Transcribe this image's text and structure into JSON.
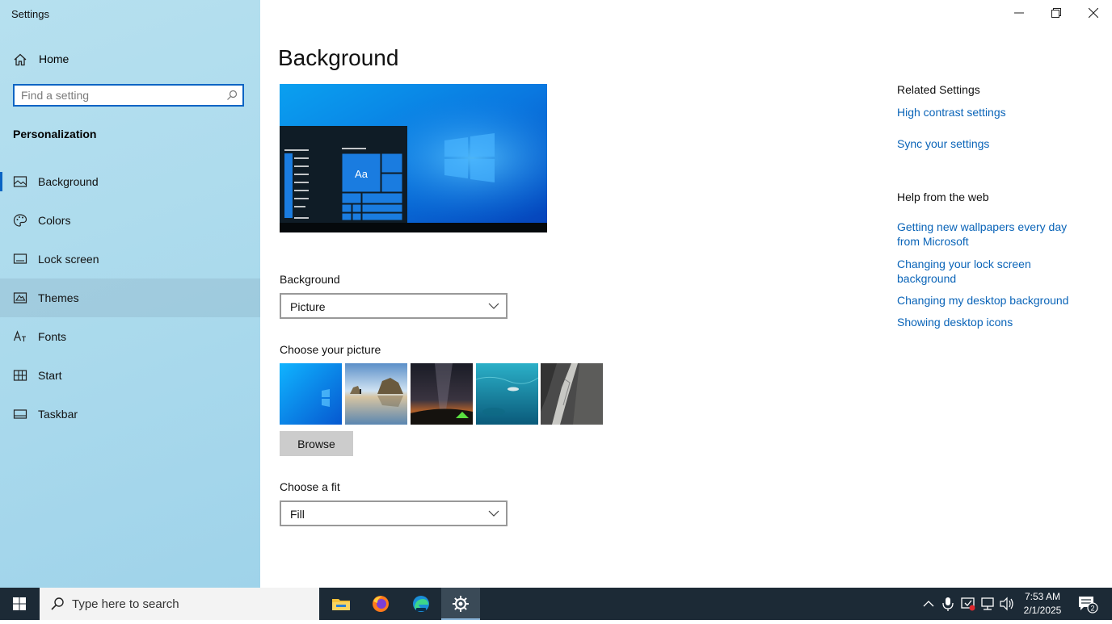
{
  "window": {
    "title": "Settings",
    "controls": [
      "minimize",
      "restore",
      "close"
    ]
  },
  "sidebar": {
    "home_label": "Home",
    "search_placeholder": "Find a setting",
    "section_label": "Personalization",
    "items": [
      {
        "label": "Background",
        "icon": "picture-icon",
        "active": true
      },
      {
        "label": "Colors",
        "icon": "palette-icon"
      },
      {
        "label": "Lock screen",
        "icon": "lock-screen-icon"
      },
      {
        "label": "Themes",
        "icon": "themes-icon",
        "hovered": true
      },
      {
        "label": "Fonts",
        "icon": "fonts-icon"
      },
      {
        "label": "Start",
        "icon": "start-icon"
      },
      {
        "label": "Taskbar",
        "icon": "taskbar-icon"
      }
    ]
  },
  "main": {
    "title": "Background",
    "preview": {
      "tile_text": "Aa"
    },
    "background_label": "Background",
    "background_value": "Picture",
    "choose_picture_label": "Choose your picture",
    "pictures": [
      "windows-blue",
      "beach-rocks",
      "night-sky-tent",
      "underwater-swimmer",
      "rock-cliff"
    ],
    "browse_label": "Browse",
    "fit_label": "Choose a fit",
    "fit_value": "Fill"
  },
  "related": {
    "heading": "Related Settings",
    "links": [
      "High contrast settings",
      "Sync your settings"
    ],
    "help_heading": "Help from the web",
    "help_links": [
      "Getting new wallpapers every day from Microsoft",
      "Changing your lock screen background",
      "Changing my desktop background",
      "Showing desktop icons"
    ]
  },
  "taskbar": {
    "search_placeholder": "Type here to search",
    "apps": [
      "file-explorer",
      "firefox",
      "edge",
      "settings"
    ],
    "active_app": "settings",
    "time": "7:53 AM",
    "date": "2/1/2025",
    "notification_count": "2"
  },
  "colors": {
    "accent": "#0a64c4",
    "link": "#0a64b8",
    "sidebar_bg": "#a9d9ec",
    "taskbar_bg": "#1c2a36"
  }
}
